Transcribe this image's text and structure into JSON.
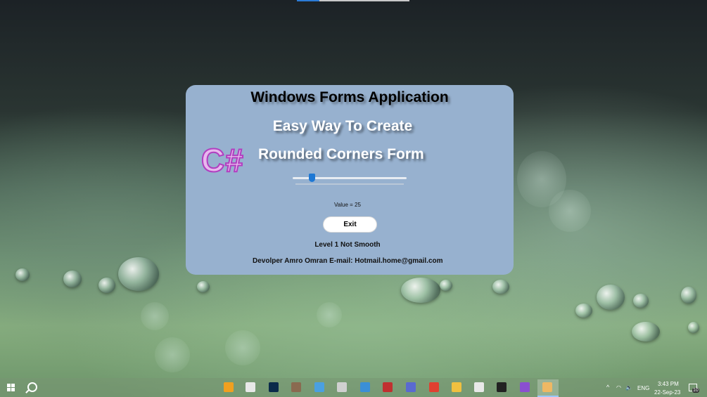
{
  "window": {
    "title": "Windows Forms Application",
    "subtitle_line1": "Easy Way To Create",
    "subtitle_line2": "Rounded Corners Form",
    "logo_text": "C#",
    "slider": {
      "value_fraction": 0.15
    },
    "value_label": "Value = 25",
    "exit_label": "Exit",
    "level_label": "Level 1 Not Smooth",
    "developer_label": "Devolper Amro Omran  E-mail: Hotmail.home@gmail.com",
    "background_color": "#97b1cf"
  },
  "taskbar": {
    "start_icon": "windows-logo-icon",
    "search_icon": "search-icon",
    "apps": [
      {
        "name": "search-app-icon",
        "color": "#f0a020"
      },
      {
        "name": "store-icon",
        "color": "#e8e8e8"
      },
      {
        "name": "photoshop-icon",
        "color": "#0b2a4a"
      },
      {
        "name": "photo-icon",
        "color": "#8a6a50"
      },
      {
        "name": "app-icon",
        "color": "#4aa0e0"
      },
      {
        "name": "gamepad-icon",
        "color": "#d0d0d0"
      },
      {
        "name": "visual-studio-code-icon",
        "color": "#3b8fd6"
      },
      {
        "name": "tools-icon",
        "color": "#c03030"
      },
      {
        "name": "gear-blue-icon",
        "color": "#5a6ad0"
      },
      {
        "name": "chrome-icon",
        "color": "#e04030"
      },
      {
        "name": "file-explorer-icon",
        "color": "#f0c040"
      },
      {
        "name": "settings-icon",
        "color": "#e8e8e8"
      },
      {
        "name": "obs-icon",
        "color": "#222222"
      },
      {
        "name": "visual-studio-icon",
        "color": "#8a4fd0"
      },
      {
        "name": "winforms-app-icon",
        "color": "#e8a030"
      }
    ],
    "tray": {
      "language": "ENG",
      "time": "3:43 PM",
      "date": "22-Sep-23",
      "notification_count": "10"
    }
  }
}
